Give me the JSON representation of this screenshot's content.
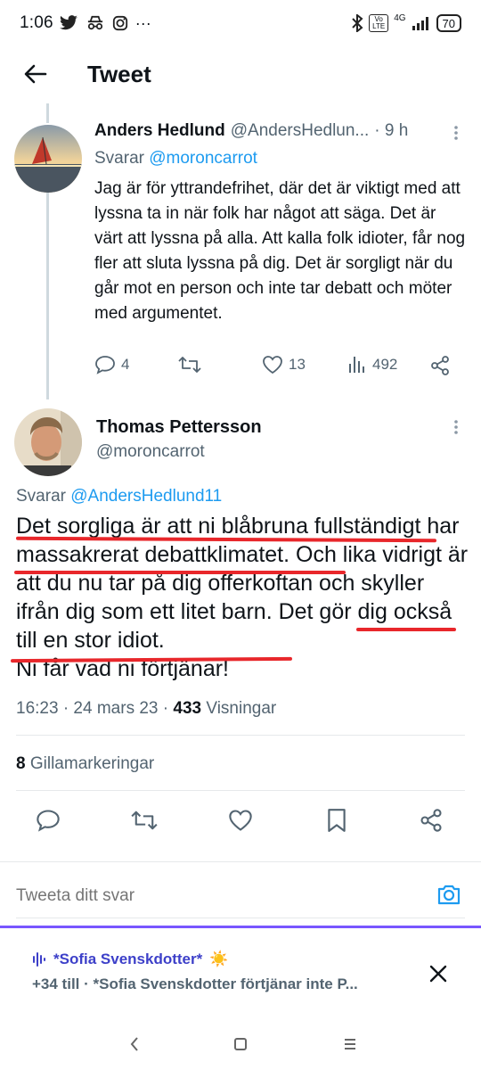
{
  "status_bar": {
    "time": "1:06",
    "network": "4G",
    "volte": "Vo LTE",
    "battery": "70",
    "overflow": "···"
  },
  "header": {
    "title": "Tweet",
    "back_icon": "arrow-left-icon"
  },
  "reply_tweet": {
    "author_name": "Anders Hedlund",
    "author_handle": "@AndersHedlun...",
    "time_ago": "· 9 h",
    "replying_prefix": "Svarar",
    "replying_to": "@moroncarrot",
    "text": "Jag är för yttrandefrihet, där det är viktigt med att lyssna ta in när folk har något att säga. Det är värt att lyssna på alla. Att kalla folk idioter, får nog fler att sluta lyssna på dig. Det är sorgligt när du går mot en person och inte tar debatt och möter med argumentet.",
    "replies": "4",
    "retweets": "",
    "likes": "13",
    "views": "492"
  },
  "main_tweet": {
    "author_name": "Thomas Pettersson",
    "author_handle": "@moroncarrot",
    "replying_prefix": "Svarar",
    "replying_to": "@AndersHedlund11",
    "text": "Det sorgliga är att ni blåbruna fullständigt har massakrerat debattklimatet. Och lika vidrigt är att du nu tar på dig offerkoftan och skyller ifrån dig som ett litet barn. Det gör dig också till en stor idiot.",
    "text_last_line": "Ni får vad ni förtjänar!",
    "time": "16:23 · 24 mars 23 ·",
    "views_count": "433",
    "views_label": "Visningar",
    "likes_count": "8",
    "likes_label": "Gillamarkeringar",
    "annotation_color": "#e8272b"
  },
  "reply_composer": {
    "placeholder": "Tweeta ditt svar"
  },
  "notification": {
    "title": "*Sofia Svenskdotter*",
    "subtitle": "+34 till · *Sofia Svenskdotter förtjänar inte P...",
    "emoji": "☀️"
  },
  "colors": {
    "accent": "#1d9bf0",
    "secondary_text": "#536471",
    "spaces_purple": "#7856ff",
    "notif_title": "#3d40c9"
  }
}
